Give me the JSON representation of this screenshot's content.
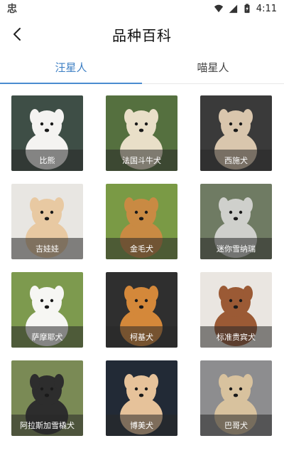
{
  "status_bar": {
    "app_icon": "忠",
    "time": "4:11",
    "icons": [
      "wifi-icon",
      "signal-icon",
      "battery-icon"
    ]
  },
  "header": {
    "back_icon": "back-arrow-icon",
    "title": "品种百科"
  },
  "tabs": [
    {
      "label": "汪星人",
      "active": true
    },
    {
      "label": "喵星人",
      "active": false
    }
  ],
  "breeds": [
    {
      "name": "比熊",
      "bg": "#3e4e46",
      "dog": "#f4f3f1"
    },
    {
      "name": "法国斗牛犬",
      "bg": "#55703f",
      "dog": "#e9dfc8"
    },
    {
      "name": "西施犬",
      "bg": "#3a3a3a",
      "dog": "#d9c6ad"
    },
    {
      "name": "吉娃娃",
      "bg": "#e8e6e2",
      "dog": "#e8c9a2"
    },
    {
      "name": "金毛犬",
      "bg": "#7a9a45",
      "dog": "#c98a43"
    },
    {
      "name": "迷你雪纳瑞",
      "bg": "#6f7b63",
      "dog": "#cfd0cc"
    },
    {
      "name": "萨摩耶犬",
      "bg": "#7d9a4e",
      "dog": "#f6f6f3"
    },
    {
      "name": "柯基犬",
      "bg": "#2f2f2f",
      "dog": "#d4883a"
    },
    {
      "name": "标准贵宾犬",
      "bg": "#eae6e1",
      "dog": "#9b5a35"
    },
    {
      "name": "阿拉斯加雪橇犬",
      "bg": "#7a8a55",
      "dog": "#2d2d2d"
    },
    {
      "name": "博美犬",
      "bg": "#222a36",
      "dog": "#e6c29a"
    },
    {
      "name": "巴哥犬",
      "bg": "#8d8d8f",
      "dog": "#d8c29e"
    }
  ]
}
